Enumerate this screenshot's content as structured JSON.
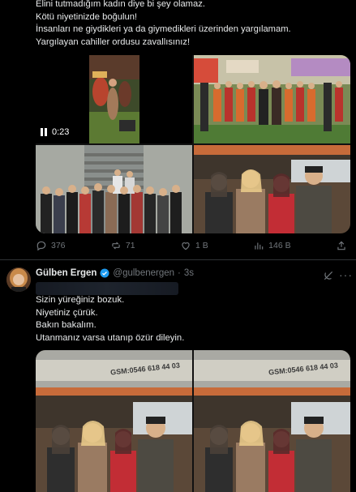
{
  "tweet1": {
    "lines": [
      "Elini tutmadığım kadın diye bi şey olamaz.",
      "Kötü niyetinizde boğulun!",
      "İnsanları ne giydikleri ya da giymedikleri üzerinden yargılamam.",
      "Yargılayan cahiller ordusu zavallısınız!"
    ],
    "video_time": "0:23",
    "actions": {
      "replies": "376",
      "reposts": "71",
      "likes": "1 B",
      "views": "146 B"
    }
  },
  "tweet2": {
    "name": "Gülben Ergen",
    "handle": "@gulbenergen",
    "sep": "·",
    "time": "3s",
    "lines": [
      "Sizin yüreğiniz bozuk.",
      "Niyetiniz çürük.",
      "Bakın bakalım.",
      "Utanmanız varsa utanıp özür dileyin."
    ],
    "sign_text": "GSM:0546 618 44 03"
  },
  "colors": {
    "background": "#000000",
    "text": "#e7e9ea",
    "muted": "#71767b",
    "verified": "#1d9bf0",
    "divider": "#2f3336"
  }
}
